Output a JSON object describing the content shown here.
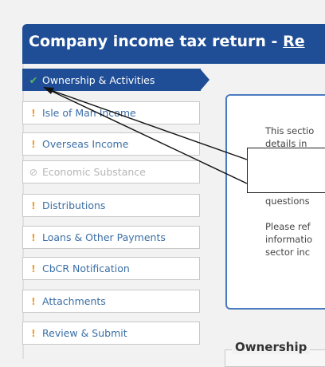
{
  "header": {
    "title": "Company income tax return - ",
    "title_link": "Re"
  },
  "nav": {
    "items": [
      {
        "label": "Ownership & Activities",
        "icon": "✔",
        "state": "active"
      },
      {
        "label": "Isle of Man Income",
        "icon": "!",
        "state": "warn"
      },
      {
        "label": "Overseas Income",
        "icon": "!",
        "state": "warn"
      },
      {
        "label": "Economic Substance",
        "icon": "⊘",
        "state": "disabled"
      },
      {
        "label": "Distributions",
        "icon": "!",
        "state": "warn"
      },
      {
        "label": "Loans & Other Payments",
        "icon": "!",
        "state": "warn"
      },
      {
        "label": "CbCR Notification",
        "icon": "!",
        "state": "warn"
      },
      {
        "label": "Attachments",
        "icon": "!",
        "state": "warn"
      },
      {
        "label": "Review & Submit",
        "icon": "!",
        "state": "warn"
      }
    ]
  },
  "panel": {
    "line1": "This sectio",
    "line2": "details in",
    "line3": "questions",
    "line4": "Please ref",
    "line5": "informatio",
    "line6": "sector inc"
  },
  "section": {
    "ownership_legend": "Ownership"
  },
  "colors": {
    "brand": "#1f4e96",
    "warning": "#f0a030",
    "success": "#5cb85c",
    "link": "#3a6ea5"
  }
}
